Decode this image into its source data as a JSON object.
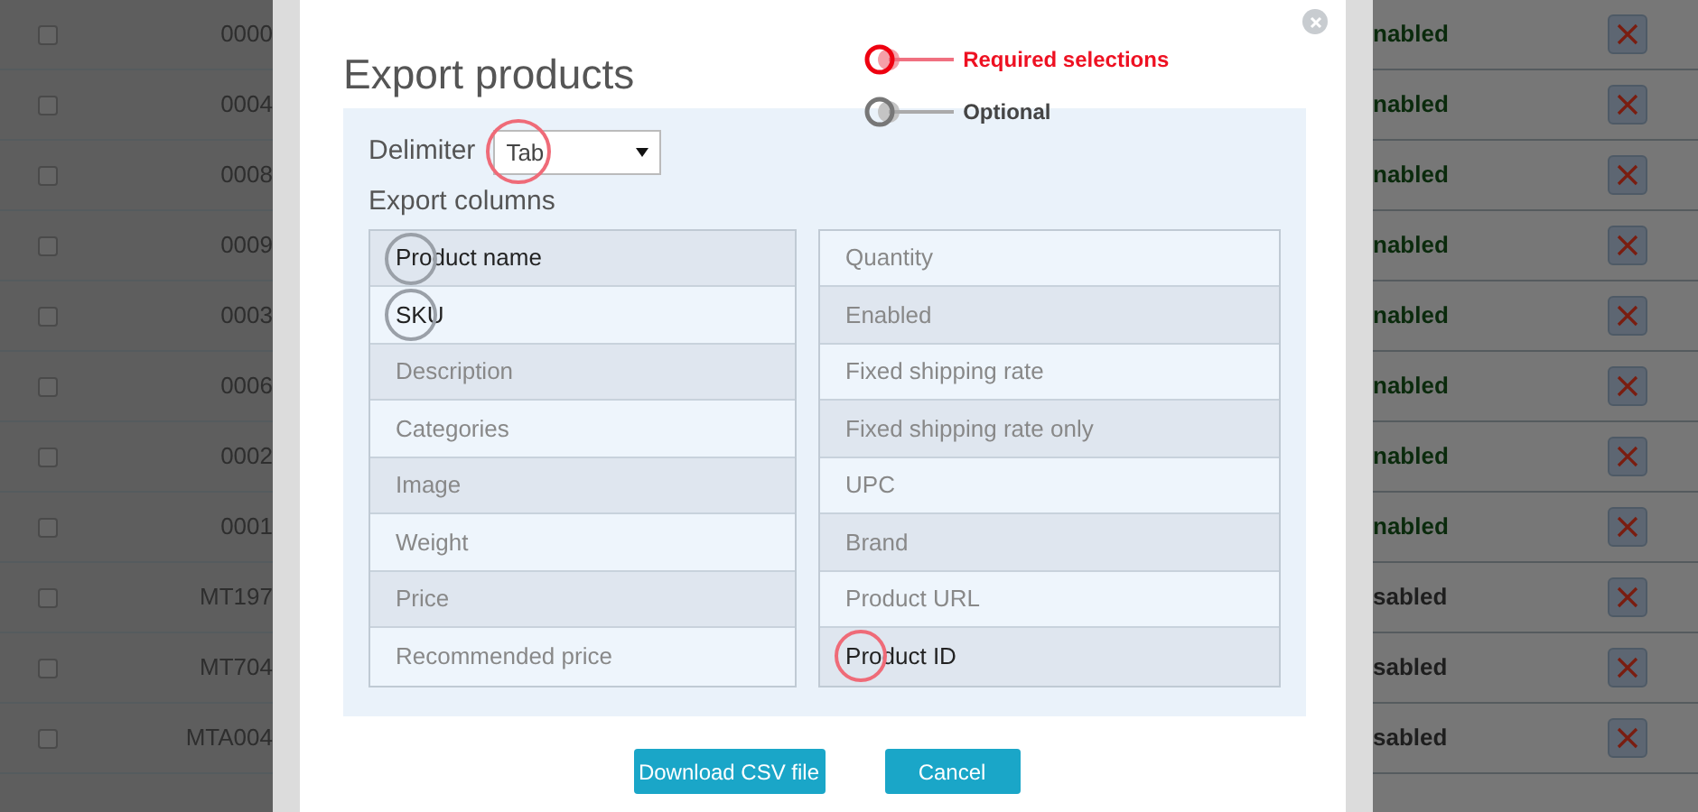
{
  "background_table": {
    "rows": [
      {
        "checked": false,
        "code": "0000",
        "status": "nabled",
        "enabled": true
      },
      {
        "checked": false,
        "code": "0004",
        "status": "nabled",
        "enabled": true
      },
      {
        "checked": false,
        "code": "0008",
        "status": "nabled",
        "enabled": true
      },
      {
        "checked": false,
        "code": "0009",
        "status": "nabled",
        "enabled": true
      },
      {
        "checked": false,
        "code": "0003",
        "status": "nabled",
        "enabled": true
      },
      {
        "checked": false,
        "code": "0006",
        "status": "nabled",
        "enabled": true
      },
      {
        "checked": false,
        "code": "0002",
        "status": "nabled",
        "enabled": true
      },
      {
        "checked": false,
        "code": "0001",
        "status": "nabled",
        "enabled": true
      },
      {
        "checked": false,
        "code": "MT197",
        "status": "sabled",
        "enabled": false
      },
      {
        "checked": false,
        "code": "MT704",
        "status": "sabled",
        "enabled": false
      },
      {
        "checked": false,
        "code": "MTA004",
        "status": "sabled",
        "enabled": false
      }
    ]
  },
  "dialog": {
    "title": "Export products",
    "legend": [
      {
        "label": "Required selections",
        "kind": "required"
      },
      {
        "label": "Optional",
        "kind": "optional"
      }
    ],
    "delimiter": {
      "label": "Delimiter",
      "value": "Tab",
      "highlighted": true,
      "required": true
    },
    "columns_label": "Export columns",
    "columns": [
      [
        {
          "label": "Product name",
          "selected": true,
          "highlighted": true,
          "required": false
        },
        {
          "label": "SKU",
          "selected": true,
          "highlighted": true,
          "required": false
        },
        {
          "label": "Description",
          "selected": false,
          "highlighted": false
        },
        {
          "label": "Categories",
          "selected": false,
          "highlighted": false
        },
        {
          "label": "Image",
          "selected": false,
          "highlighted": false
        },
        {
          "label": "Weight",
          "selected": false,
          "highlighted": false
        },
        {
          "label": "Price",
          "selected": false,
          "highlighted": false
        },
        {
          "label": "Recommended price",
          "selected": false,
          "highlighted": false
        }
      ],
      [
        {
          "label": "Quantity",
          "selected": false,
          "highlighted": false
        },
        {
          "label": "Enabled",
          "selected": false,
          "highlighted": false
        },
        {
          "label": "Fixed shipping rate",
          "selected": false,
          "highlighted": false
        },
        {
          "label": "Fixed shipping rate only",
          "selected": false,
          "highlighted": false
        },
        {
          "label": "UPC",
          "selected": false,
          "highlighted": false
        },
        {
          "label": "Brand",
          "selected": false,
          "highlighted": false
        },
        {
          "label": "Product URL",
          "selected": false,
          "highlighted": false
        },
        {
          "label": "Product ID",
          "selected": true,
          "highlighted": true,
          "required": true
        }
      ]
    ],
    "buttons": [
      "Download CSV file",
      "Cancel"
    ]
  }
}
